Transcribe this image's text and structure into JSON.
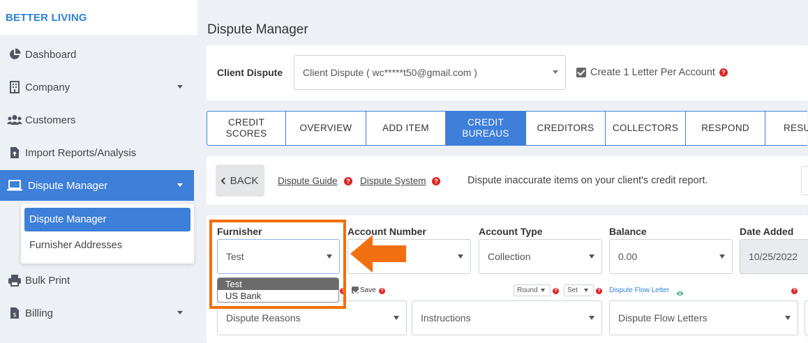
{
  "brand": "BETTER LIVING",
  "sidebar": {
    "items": [
      {
        "label": "Dashboard",
        "icon": "pie-chart-icon"
      },
      {
        "label": "Company",
        "icon": "building-icon"
      },
      {
        "label": "Customers",
        "icon": "users-icon"
      },
      {
        "label": "Import Reports/Analysis",
        "icon": "file-upload-icon"
      },
      {
        "label": "Dispute Manager",
        "icon": "laptop-icon"
      },
      {
        "label": "Bulk Print",
        "icon": "printer-icon"
      },
      {
        "label": "Billing",
        "icon": "invoice-icon"
      }
    ],
    "submenu": [
      "Dispute Manager",
      "Furnisher Addresses"
    ]
  },
  "page_title": "Dispute Manager",
  "client_dispute": {
    "label": "Client Dispute",
    "value": "Client Dispute ( wc*****t50@gmail.com )",
    "checkbox_label": "Create 1 Letter Per Account",
    "checked": true
  },
  "tabs": [
    {
      "label": "CREDIT SCORES"
    },
    {
      "label": "OVERVIEW"
    },
    {
      "label": "ADD ITEM"
    },
    {
      "label": "CREDIT BUREAUS"
    },
    {
      "label": "CREDITORS"
    },
    {
      "label": "COLLECTORS"
    },
    {
      "label": "RESPOND"
    },
    {
      "label": "RESU"
    }
  ],
  "toolbar": {
    "back_label": "BACK",
    "guide_link": "Dispute Guide",
    "system_link": "Dispute System",
    "description": "Dispute inaccurate items on your client's credit report."
  },
  "form": {
    "furnisher": {
      "label": "Furnisher",
      "value": "Test",
      "options": [
        "Test",
        "US Bank"
      ]
    },
    "account_number": {
      "label": "Account Number",
      "value": ""
    },
    "account_type": {
      "label": "Account Type",
      "value": "Collection"
    },
    "balance": {
      "label": "Balance",
      "value": "0.00"
    },
    "date_added": {
      "label": "Date Added",
      "value": "10/25/2022"
    },
    "save_label": "Save",
    "round_value": "Round",
    "set_value": "Set",
    "dispute_flow_label": "Dispute Flow Letter",
    "dispute_reasons": "Dispute Reasons",
    "instructions": "Instructions",
    "dispute_flow_letters": "Dispute Flow Letters"
  },
  "colors": {
    "accent": "#3d7fd9",
    "highlight": "#f26f0f",
    "help": "#e02424"
  }
}
